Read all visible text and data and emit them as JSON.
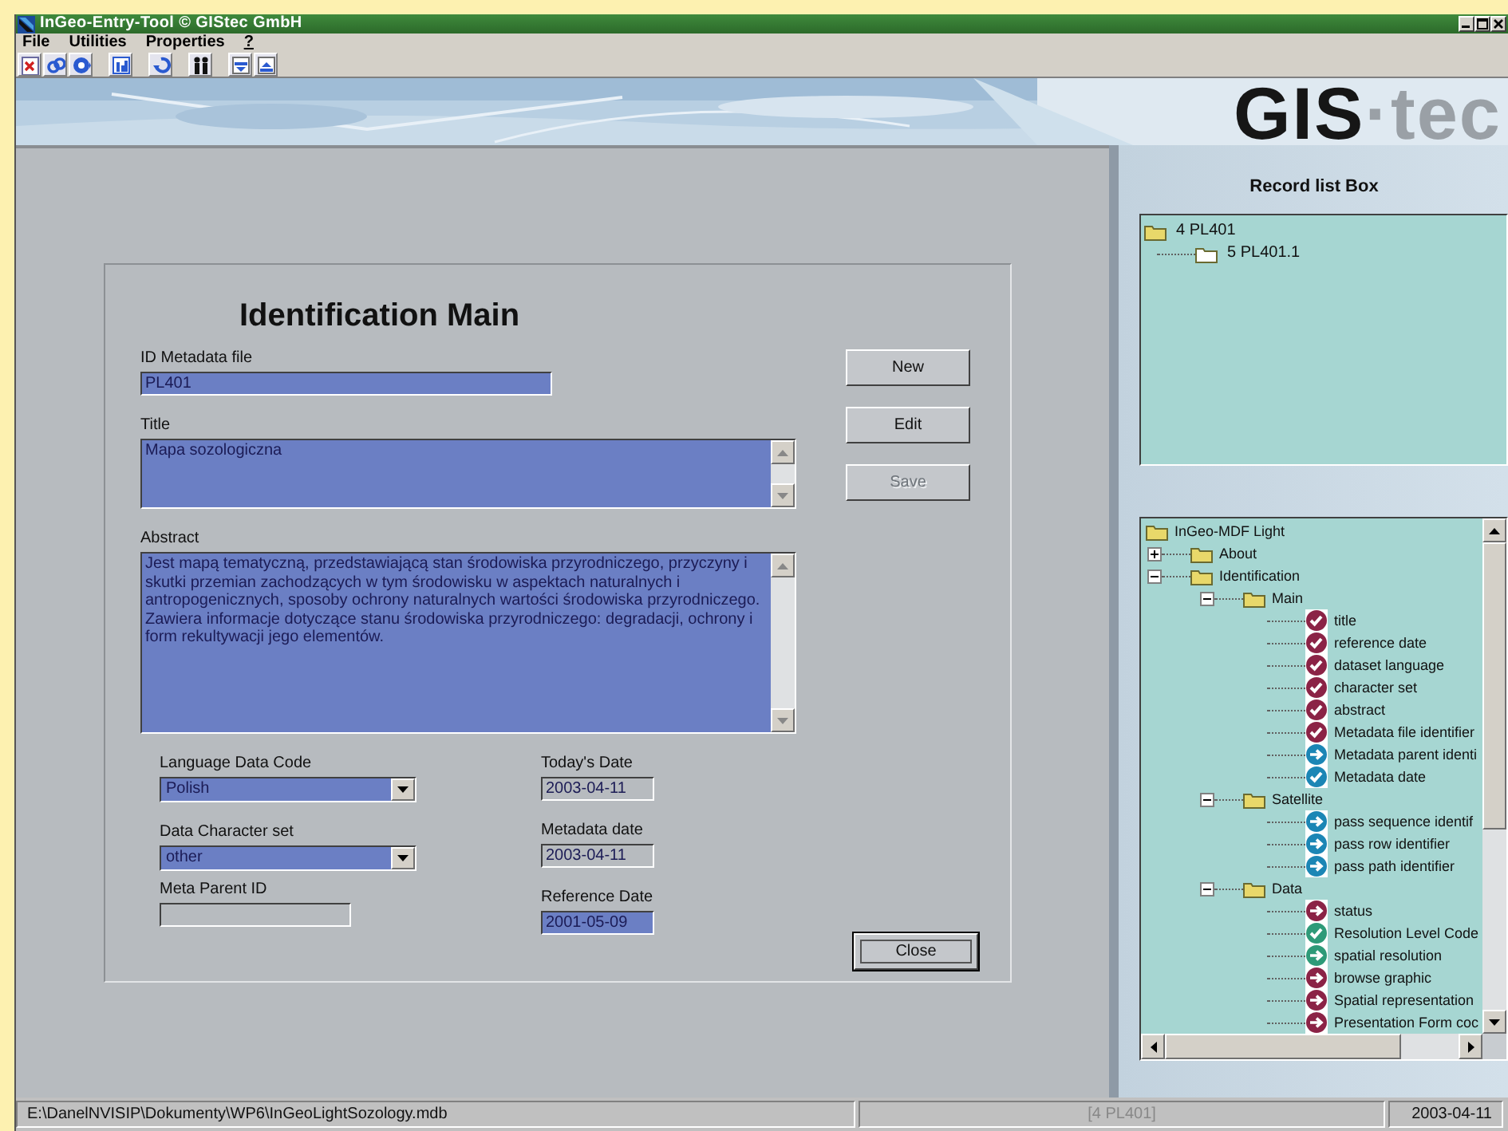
{
  "window": {
    "title": "InGeo-Entry-Tool © GIStec GmbH"
  },
  "menu": [
    {
      "label": "File",
      "underlined": false
    },
    {
      "label": "Utilities",
      "underlined": false
    },
    {
      "label": "Properties",
      "underlined": false
    },
    {
      "label": "?",
      "underlined": true
    }
  ],
  "toolbar": [
    [
      {
        "kind": "delete"
      },
      {
        "kind": "link"
      },
      {
        "kind": "record"
      }
    ],
    [
      {
        "kind": "chart"
      }
    ],
    [
      {
        "kind": "undo"
      }
    ],
    [
      {
        "kind": "people"
      }
    ],
    [
      {
        "kind": "xml-export"
      },
      {
        "kind": "xml-import"
      }
    ]
  ],
  "banner": {
    "logo_main": "GIS",
    "logo_tail": "·tec"
  },
  "form": {
    "title": "Identification Main",
    "fields": [
      {
        "kind": "line",
        "label": "ID Metadata file",
        "value": "PL401",
        "editable": true
      },
      {
        "kind": "memo",
        "label": "Title",
        "value": "Mapa sozologiczna",
        "editable": true
      },
      {
        "kind": "memo",
        "label": "Abstract",
        "value": "Jest mapą tematyczną, przedstawiającą stan środowiska przyrodniczego, przyczyny i skutki przemian zachodzących w tym środowisku w aspektach naturalnych i antropogenicznych, sposoby ochrony naturalnych wartości środowiska przyrodniczego. Zawiera informacje dotyczące stanu środowiska przyrodniczego: degradacji, ochrony i form rekultywacji jego elementów.",
        "editable": true
      }
    ],
    "buttons": [
      {
        "label": "New",
        "disabled": false,
        "focused": false
      },
      {
        "label": "Edit",
        "disabled": false,
        "focused": false
      },
      {
        "label": "Save",
        "disabled": true,
        "focused": false
      }
    ],
    "left_fields": [
      {
        "kind": "select",
        "label": "Language Data Code",
        "value": "Polish",
        "editable": true
      },
      {
        "kind": "select",
        "label": "Data Character set",
        "value": "other",
        "editable": true
      },
      {
        "kind": "line",
        "label": "Meta Parent ID",
        "editable": false
      }
    ],
    "right_fields": [
      {
        "kind": "line",
        "label": "Today's Date",
        "value": "2003-04-11",
        "editable": false
      },
      {
        "kind": "line",
        "label": "Metadata date",
        "value": "2003-04-11",
        "editable": false
      },
      {
        "kind": "line",
        "label": "Reference Date",
        "value": "2001-05-09",
        "editable": true
      }
    ],
    "close_button": {
      "label": "Close",
      "disabled": false,
      "focused": true
    }
  },
  "record_list": {
    "title": "Record list Box",
    "items": [
      {
        "label": "4 PL401",
        "selected": false,
        "children": [
          {
            "label": "5 PL401.1",
            "selected": true
          }
        ]
      }
    ]
  },
  "outline": {
    "items": [
      {
        "label": "InGeo-MDF Light",
        "kind": "folder",
        "children": [
          {
            "label": "About",
            "kind": "folder",
            "expanded": false
          },
          {
            "label": "Identification",
            "kind": "folder",
            "expanded": true,
            "children": [
              {
                "label": "Main",
                "kind": "folder",
                "expanded": true,
                "children": [
                  {
                    "label": "title",
                    "kind": "check",
                    "color": "#8b2346"
                  },
                  {
                    "label": "reference date",
                    "kind": "check",
                    "color": "#8b2346"
                  },
                  {
                    "label": "dataset language",
                    "kind": "check",
                    "color": "#8b2346"
                  },
                  {
                    "label": "character set",
                    "kind": "check",
                    "color": "#8b2346"
                  },
                  {
                    "label": "abstract",
                    "kind": "check",
                    "color": "#8b2346"
                  },
                  {
                    "label": "Metadata file identifier",
                    "kind": "check",
                    "color": "#8b2346"
                  },
                  {
                    "label": "Metadata parent identi",
                    "kind": "arrow",
                    "color": "#1b86b5"
                  },
                  {
                    "label": "Metadata date",
                    "kind": "check",
                    "color": "#1b86b5"
                  }
                ]
              },
              {
                "label": "Satellite",
                "kind": "folder",
                "expanded": true,
                "children": [
                  {
                    "label": "pass sequence identif",
                    "kind": "arrow",
                    "color": "#1b86b5"
                  },
                  {
                    "label": "pass row identifier",
                    "kind": "arrow",
                    "color": "#1b86b5"
                  },
                  {
                    "label": "pass path identifier",
                    "kind": "arrow",
                    "color": "#1b86b5"
                  }
                ]
              },
              {
                "label": "Data",
                "kind": "folder",
                "expanded": true,
                "children": [
                  {
                    "label": "status",
                    "kind": "arrow",
                    "color": "#8b2346"
                  },
                  {
                    "label": "Resolution Level Code",
                    "kind": "check",
                    "color": "#2e9a78"
                  },
                  {
                    "label": "spatial resolution",
                    "kind": "arrow",
                    "color": "#2e9a78"
                  },
                  {
                    "label": "browse graphic",
                    "kind": "arrow",
                    "color": "#8b2346"
                  },
                  {
                    "label": "Spatial representation",
                    "kind": "arrow",
                    "color": "#8b2346"
                  },
                  {
                    "label": "Presentation Form coc",
                    "kind": "arrow",
                    "color": "#8b2346"
                  }
                ]
              }
            ]
          }
        ]
      }
    ]
  },
  "status_bar": [
    {
      "text": "E:\\DanelNVISIP\\Dokumenty\\WP6\\InGeoLightSozology.mdb",
      "dimmed": false
    },
    {
      "text": "[4 PL401]",
      "dimmed": true
    },
    {
      "text": "2003-04-11",
      "dimmed": false
    }
  ]
}
